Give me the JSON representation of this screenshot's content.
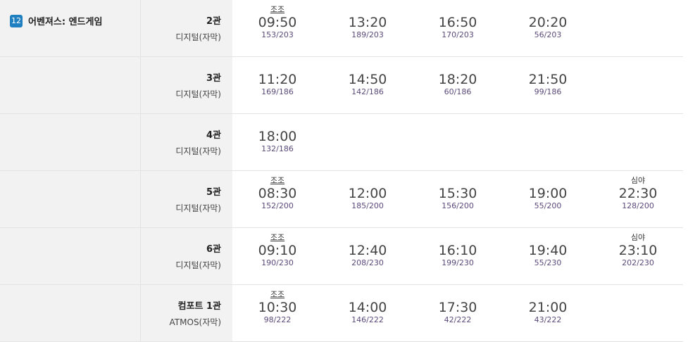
{
  "movie": {
    "rating": "12",
    "title": "어벤져스: 엔드게임"
  },
  "colors": {
    "rating_badge": "#1f7fc0",
    "seats": "#5a4a7a"
  },
  "rows": [
    {
      "hall": "2관",
      "format": "디지털(자막)",
      "slots": [
        {
          "tag": "조조",
          "time": "09:50",
          "seats": "153/203"
        },
        {
          "tag": "",
          "time": "13:20",
          "seats": "189/203"
        },
        {
          "tag": "",
          "time": "16:50",
          "seats": "170/203"
        },
        {
          "tag": "",
          "time": "20:20",
          "seats": "56/203"
        }
      ]
    },
    {
      "hall": "3관",
      "format": "디지털(자막)",
      "slots": [
        {
          "tag": "",
          "time": "11:20",
          "seats": "169/186"
        },
        {
          "tag": "",
          "time": "14:50",
          "seats": "142/186"
        },
        {
          "tag": "",
          "time": "18:20",
          "seats": "60/186"
        },
        {
          "tag": "",
          "time": "21:50",
          "seats": "99/186"
        }
      ]
    },
    {
      "hall": "4관",
      "format": "디지털(자막)",
      "slots": [
        {
          "tag": "",
          "time": "18:00",
          "seats": "132/186"
        }
      ]
    },
    {
      "hall": "5관",
      "format": "디지털(자막)",
      "slots": [
        {
          "tag": "조조",
          "time": "08:30",
          "seats": "152/200"
        },
        {
          "tag": "",
          "time": "12:00",
          "seats": "185/200"
        },
        {
          "tag": "",
          "time": "15:30",
          "seats": "156/200"
        },
        {
          "tag": "",
          "time": "19:00",
          "seats": "55/200"
        },
        {
          "tag": "심야",
          "time": "22:30",
          "seats": "128/200"
        }
      ]
    },
    {
      "hall": "6관",
      "format": "디지털(자막)",
      "slots": [
        {
          "tag": "조조",
          "time": "09:10",
          "seats": "190/230"
        },
        {
          "tag": "",
          "time": "12:40",
          "seats": "208/230"
        },
        {
          "tag": "",
          "time": "16:10",
          "seats": "199/230"
        },
        {
          "tag": "",
          "time": "19:40",
          "seats": "55/230"
        },
        {
          "tag": "심야",
          "time": "23:10",
          "seats": "202/230"
        }
      ]
    },
    {
      "hall": "컴포트 1관",
      "format": "ATMOS(자막)",
      "slots": [
        {
          "tag": "조조",
          "time": "10:30",
          "seats": "98/222"
        },
        {
          "tag": "",
          "time": "14:00",
          "seats": "146/222"
        },
        {
          "tag": "",
          "time": "17:30",
          "seats": "42/222"
        },
        {
          "tag": "",
          "time": "21:00",
          "seats": "43/222"
        }
      ]
    }
  ]
}
